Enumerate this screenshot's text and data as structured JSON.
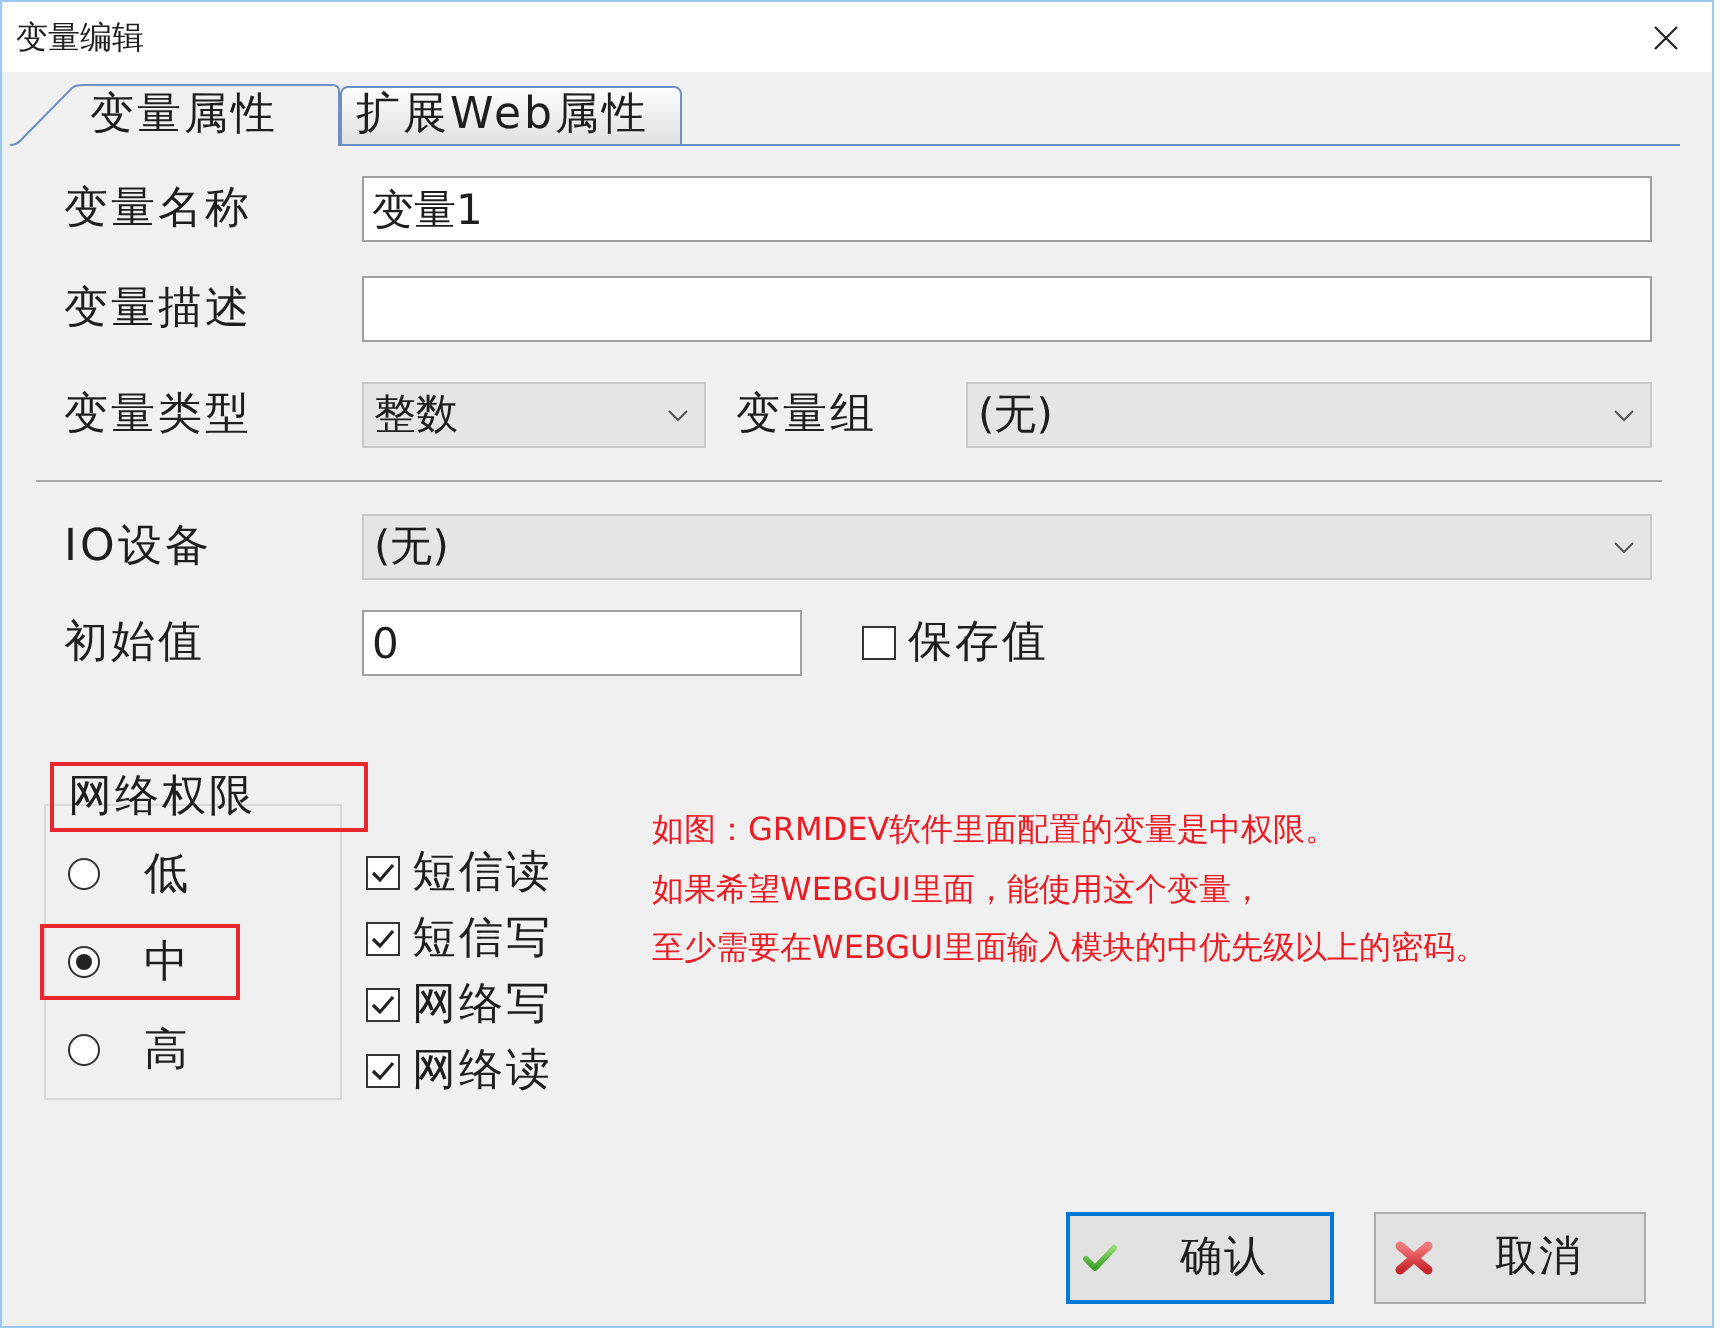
{
  "window": {
    "title": "变量编辑"
  },
  "tabs": [
    {
      "label": "变量属性",
      "selected": true
    },
    {
      "label": "扩展Web属性",
      "selected": false
    }
  ],
  "variable_name": {
    "label": "变量名称",
    "value": "变量1"
  },
  "variable_description": {
    "label": "变量描述"
  },
  "variable_type": {
    "label": "变量类型",
    "value": "整数"
  },
  "variable_group": {
    "label": "变量组",
    "value": "(无)"
  },
  "io_device": {
    "label": "IO设备",
    "value": "(无)"
  },
  "initial_value": {
    "label": "初始值",
    "value": "0"
  },
  "save_value": {
    "label": "保存值",
    "checked": false
  },
  "network_permission": {
    "title": "网络权限",
    "highlighted": true,
    "options": [
      {
        "label": "低",
        "selected": false,
        "highlighted": false
      },
      {
        "label": "中",
        "selected": true,
        "highlighted": true
      },
      {
        "label": "高",
        "selected": false,
        "highlighted": false
      }
    ]
  },
  "access_rights": [
    {
      "label": "短信读",
      "checked": true
    },
    {
      "label": "短信写",
      "checked": true
    },
    {
      "label": "网络写",
      "checked": true
    },
    {
      "label": "网络读",
      "checked": true
    }
  ],
  "note": [
    "如图：GRMDEV软件里面配置的变量是中权限。",
    "如果希望WEBGUI里面，能使用这个变量，",
    "至少需要在WEBGUI里面输入模块的中优先级以上的密码。"
  ],
  "buttons": [
    {
      "label": "确认",
      "kind": "confirm",
      "focused": true
    },
    {
      "label": "取消",
      "kind": "cancel",
      "focused": false
    }
  ]
}
